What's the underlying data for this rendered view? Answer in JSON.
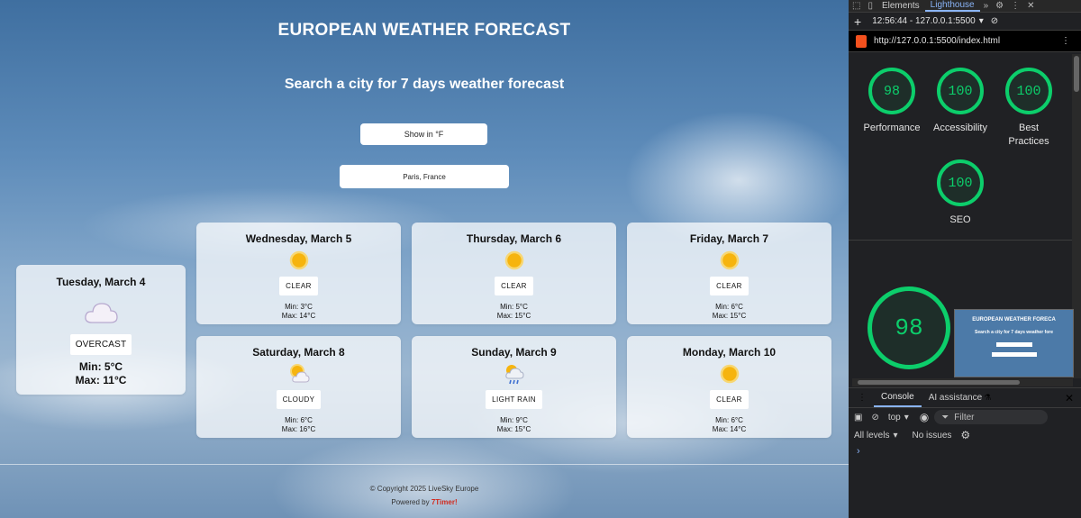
{
  "page": {
    "title": "EUROPEAN WEATHER FORECAST",
    "subtitle": "Search a city for 7 days weather forecast",
    "unit_button": "Show in °F",
    "city_value": "Paris, France"
  },
  "today": {
    "day": "Tuesday, March 4",
    "icon": "cloud-icon",
    "condition": "OVERCAST",
    "min": "Min: 5°C",
    "max": "Max: 11°C"
  },
  "forecast": [
    {
      "day": "Wednesday, March 5",
      "icon": "sun-icon",
      "condition": "CLEAR",
      "min": "Min: 3°C",
      "max": "Max: 14°C"
    },
    {
      "day": "Thursday, March 6",
      "icon": "sun-icon",
      "condition": "CLEAR",
      "min": "Min: 5°C",
      "max": "Max: 15°C"
    },
    {
      "day": "Friday, March 7",
      "icon": "sun-icon",
      "condition": "CLEAR",
      "min": "Min: 6°C",
      "max": "Max: 15°C"
    },
    {
      "day": "Saturday, March 8",
      "icon": "partly-cloudy-icon",
      "condition": "CLOUDY",
      "min": "Min: 6°C",
      "max": "Max: 16°C"
    },
    {
      "day": "Sunday, March 9",
      "icon": "rain-icon",
      "condition": "LIGHT RAIN",
      "min": "Min: 9°C",
      "max": "Max: 15°C"
    },
    {
      "day": "Monday, March 10",
      "icon": "sun-icon",
      "condition": "CLEAR",
      "min": "Min: 6°C",
      "max": "Max: 14°C"
    }
  ],
  "footer": {
    "copyright": "© Copyright 2025 LiveSky Europe",
    "powered_prefix": "Powered by",
    "powered_brand": "7Timer!"
  },
  "devtools": {
    "tabs": [
      "Elements",
      "Lighthouse"
    ],
    "active_tab": "Lighthouse",
    "session": "12:56:44 - 127.0.0.1:5500",
    "url": "http://127.0.0.1:5500/index.html",
    "scores": [
      {
        "label": "Performance",
        "value": "98"
      },
      {
        "label": "Accessibility",
        "value": "100"
      },
      {
        "label": "Best Practices",
        "value": "100"
      },
      {
        "label": "SEO",
        "value": "100"
      }
    ],
    "big_score": "98",
    "thumb_title": "EUROPEAN WEATHER FORECA",
    "thumb_subtitle": "Search a city for 7 days weather fore",
    "console_tabs": [
      "Console",
      "AI assistance"
    ],
    "context": "top",
    "filter_placeholder": "Filter",
    "levels": "All levels",
    "issues": "No issues",
    "accent": "#0cce6b"
  }
}
